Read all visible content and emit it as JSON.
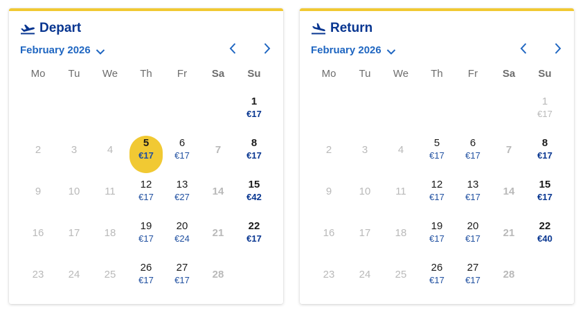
{
  "panels": [
    {
      "key": "depart",
      "title": "Depart",
      "month": "February 2026",
      "weekdays": [
        "Mo",
        "Tu",
        "We",
        "Th",
        "Fr",
        "Sa",
        "Su"
      ],
      "selected_day": "5",
      "days": [
        {
          "day": "1",
          "price": "€17",
          "state": "avail",
          "col": 6,
          "row": 0
        },
        {
          "day": "2",
          "price": "",
          "state": "disabled",
          "col": 0,
          "row": 1
        },
        {
          "day": "3",
          "price": "",
          "state": "disabled",
          "col": 1,
          "row": 1
        },
        {
          "day": "4",
          "price": "",
          "state": "disabled",
          "col": 2,
          "row": 1
        },
        {
          "day": "5",
          "price": "€17",
          "state": "selected",
          "col": 3,
          "row": 1
        },
        {
          "day": "6",
          "price": "€17",
          "state": "avail",
          "col": 4,
          "row": 1
        },
        {
          "day": "7",
          "price": "",
          "state": "disabled",
          "col": 5,
          "row": 1
        },
        {
          "day": "8",
          "price": "€17",
          "state": "avail",
          "col": 6,
          "row": 1
        },
        {
          "day": "9",
          "price": "",
          "state": "disabled",
          "col": 0,
          "row": 2
        },
        {
          "day": "10",
          "price": "",
          "state": "disabled",
          "col": 1,
          "row": 2
        },
        {
          "day": "11",
          "price": "",
          "state": "disabled",
          "col": 2,
          "row": 2
        },
        {
          "day": "12",
          "price": "€17",
          "state": "avail",
          "col": 3,
          "row": 2
        },
        {
          "day": "13",
          "price": "€27",
          "state": "avail",
          "col": 4,
          "row": 2
        },
        {
          "day": "14",
          "price": "",
          "state": "disabled",
          "col": 5,
          "row": 2
        },
        {
          "day": "15",
          "price": "€42",
          "state": "avail",
          "col": 6,
          "row": 2
        },
        {
          "day": "16",
          "price": "",
          "state": "disabled",
          "col": 0,
          "row": 3
        },
        {
          "day": "17",
          "price": "",
          "state": "disabled",
          "col": 1,
          "row": 3
        },
        {
          "day": "18",
          "price": "",
          "state": "disabled",
          "col": 2,
          "row": 3
        },
        {
          "day": "19",
          "price": "€17",
          "state": "avail",
          "col": 3,
          "row": 3
        },
        {
          "day": "20",
          "price": "€24",
          "state": "avail",
          "col": 4,
          "row": 3
        },
        {
          "day": "21",
          "price": "",
          "state": "disabled",
          "col": 5,
          "row": 3
        },
        {
          "day": "22",
          "price": "€17",
          "state": "avail",
          "col": 6,
          "row": 3
        },
        {
          "day": "23",
          "price": "",
          "state": "disabled",
          "col": 0,
          "row": 4
        },
        {
          "day": "24",
          "price": "",
          "state": "disabled",
          "col": 1,
          "row": 4
        },
        {
          "day": "25",
          "price": "",
          "state": "disabled",
          "col": 2,
          "row": 4
        },
        {
          "day": "26",
          "price": "€17",
          "state": "avail",
          "col": 3,
          "row": 4
        },
        {
          "day": "27",
          "price": "€17",
          "state": "avail",
          "col": 4,
          "row": 4
        },
        {
          "day": "28",
          "price": "",
          "state": "disabled",
          "col": 5,
          "row": 4
        }
      ]
    },
    {
      "key": "return",
      "title": "Return",
      "month": "February 2026",
      "weekdays": [
        "Mo",
        "Tu",
        "We",
        "Th",
        "Fr",
        "Sa",
        "Su"
      ],
      "selected_day": "",
      "days": [
        {
          "day": "1",
          "price": "€17",
          "state": "faded",
          "col": 6,
          "row": 0
        },
        {
          "day": "2",
          "price": "",
          "state": "disabled",
          "col": 0,
          "row": 1
        },
        {
          "day": "3",
          "price": "",
          "state": "disabled",
          "col": 1,
          "row": 1
        },
        {
          "day": "4",
          "price": "",
          "state": "disabled",
          "col": 2,
          "row": 1
        },
        {
          "day": "5",
          "price": "€17",
          "state": "avail",
          "col": 3,
          "row": 1
        },
        {
          "day": "6",
          "price": "€17",
          "state": "avail",
          "col": 4,
          "row": 1
        },
        {
          "day": "7",
          "price": "",
          "state": "disabled",
          "col": 5,
          "row": 1
        },
        {
          "day": "8",
          "price": "€17",
          "state": "avail",
          "col": 6,
          "row": 1
        },
        {
          "day": "9",
          "price": "",
          "state": "disabled",
          "col": 0,
          "row": 2
        },
        {
          "day": "10",
          "price": "",
          "state": "disabled",
          "col": 1,
          "row": 2
        },
        {
          "day": "11",
          "price": "",
          "state": "disabled",
          "col": 2,
          "row": 2
        },
        {
          "day": "12",
          "price": "€17",
          "state": "avail",
          "col": 3,
          "row": 2
        },
        {
          "day": "13",
          "price": "€17",
          "state": "avail",
          "col": 4,
          "row": 2
        },
        {
          "day": "14",
          "price": "",
          "state": "disabled",
          "col": 5,
          "row": 2
        },
        {
          "day": "15",
          "price": "€17",
          "state": "avail",
          "col": 6,
          "row": 2
        },
        {
          "day": "16",
          "price": "",
          "state": "disabled",
          "col": 0,
          "row": 3
        },
        {
          "day": "17",
          "price": "",
          "state": "disabled",
          "col": 1,
          "row": 3
        },
        {
          "day": "18",
          "price": "",
          "state": "disabled",
          "col": 2,
          "row": 3
        },
        {
          "day": "19",
          "price": "€17",
          "state": "avail",
          "col": 3,
          "row": 3
        },
        {
          "day": "20",
          "price": "€17",
          "state": "avail",
          "col": 4,
          "row": 3
        },
        {
          "day": "21",
          "price": "",
          "state": "disabled",
          "col": 5,
          "row": 3
        },
        {
          "day": "22",
          "price": "€40",
          "state": "avail",
          "col": 6,
          "row": 3
        },
        {
          "day": "23",
          "price": "",
          "state": "disabled",
          "col": 0,
          "row": 4
        },
        {
          "day": "24",
          "price": "",
          "state": "disabled",
          "col": 1,
          "row": 4
        },
        {
          "day": "25",
          "price": "",
          "state": "disabled",
          "col": 2,
          "row": 4
        },
        {
          "day": "26",
          "price": "€17",
          "state": "avail",
          "col": 3,
          "row": 4
        },
        {
          "day": "27",
          "price": "€17",
          "state": "avail",
          "col": 4,
          "row": 4
        },
        {
          "day": "28",
          "price": "",
          "state": "disabled",
          "col": 5,
          "row": 4
        }
      ]
    }
  ],
  "icons": {
    "depart": "plane-takeoff-icon",
    "return": "plane-landing-icon",
    "month_toggle": "chevron-down-icon",
    "prev": "chevron-left-icon",
    "next": "chevron-right-icon"
  },
  "colors": {
    "accent_yellow": "#f1c933",
    "title_blue": "#073590",
    "link_blue": "#1f66c1",
    "price_blue": "#1f4fa0",
    "disabled_gray": "#b9b9b9"
  }
}
